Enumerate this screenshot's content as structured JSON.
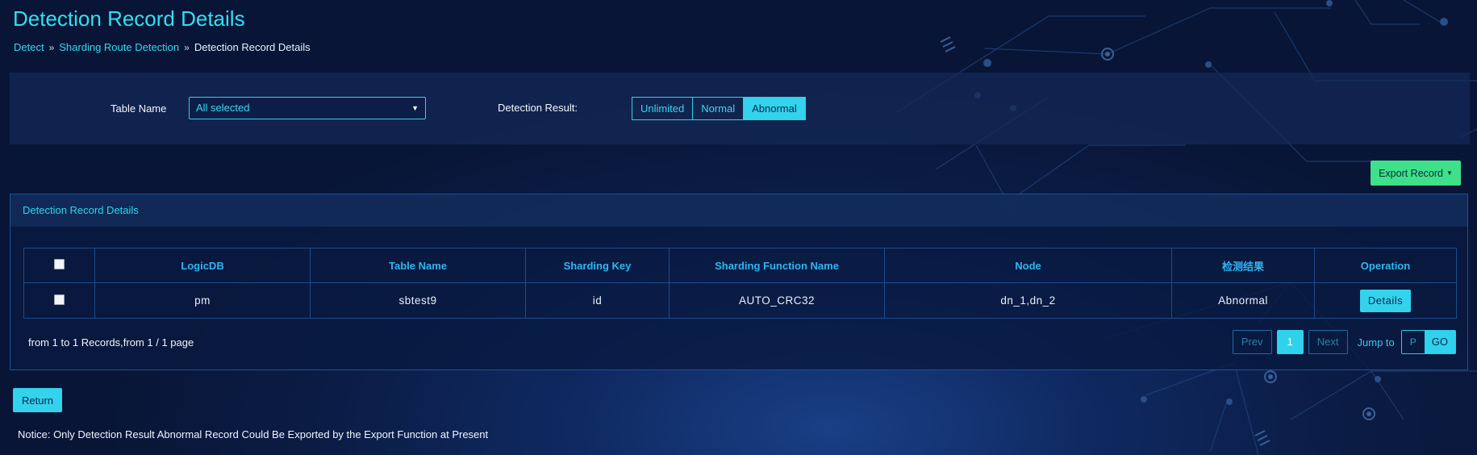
{
  "page": {
    "title": "Detection Record Details"
  },
  "breadcrumb": [
    {
      "label": "Detect"
    },
    {
      "label": "Sharding Route Detection"
    },
    {
      "label": "Detection Record Details"
    }
  ],
  "filters": {
    "table_name_label": "Table Name",
    "table_name_value": "All selected",
    "detection_result_label": "Detection Result:",
    "detection_result_options": [
      "Unlimited",
      "Normal",
      "Abnormal"
    ],
    "detection_result_selected": "Abnormal"
  },
  "toolbar": {
    "export_label": "Export Record"
  },
  "card": {
    "title": "Detection Record Details"
  },
  "table": {
    "headers": [
      "LogicDB",
      "Table Name",
      "Sharding Key",
      "Sharding Function Name",
      "Node",
      "检测结果",
      "Operation"
    ],
    "rows": [
      {
        "logicdb": "pm",
        "table_name": "sbtest9",
        "sharding_key": "id",
        "sharding_function": "AUTO_CRC32",
        "node": "dn_1,dn_2",
        "result": "Abnormal",
        "operation": "Details"
      }
    ]
  },
  "pagination": {
    "info": "from 1 to 1 Records,from 1 / 1 page",
    "prev": "Prev",
    "current": "1",
    "next": "Next",
    "jump_label": "Jump to",
    "page_placeholder": "P",
    "go": "GO"
  },
  "footer": {
    "return_label": "Return",
    "notice": "Notice: Only Detection Result Abnormal Record Could Be Exported by the Export Function at Present"
  },
  "colors": {
    "accent": "#33d3ec",
    "export": "#3fe08a",
    "background": "#0b1c45"
  }
}
